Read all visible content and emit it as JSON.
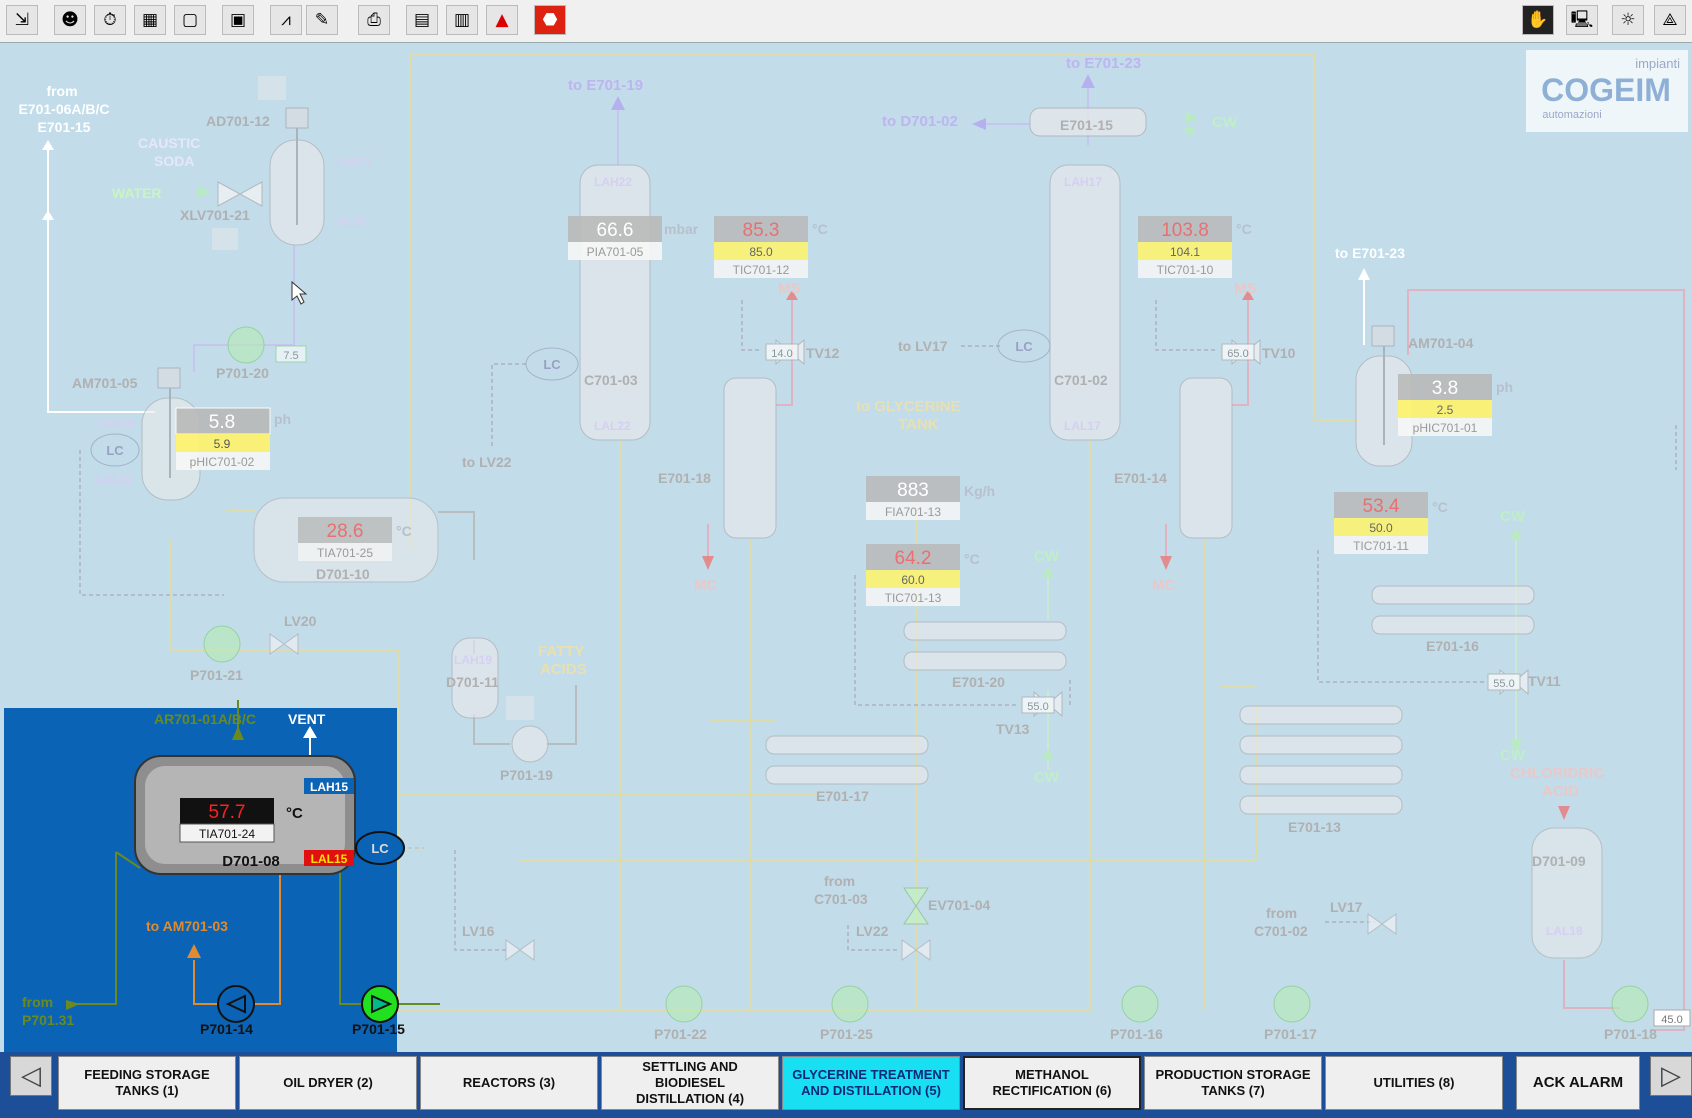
{
  "toolbar": {
    "left_icons": [
      "exit-icon",
      "users-icon",
      "stopwatch-icon",
      "calculator-icon",
      "display-icon",
      "counter-icon",
      "trend-icon",
      "report-icon",
      "printer-icon",
      "archive-icon",
      "table-icon",
      "warning-icon",
      "stop-icon"
    ],
    "right_icons": [
      "hand-stop-icon",
      "computer-icon",
      "brightness-icon",
      "tank-icon"
    ]
  },
  "logo": {
    "top": "impianti",
    "brand": "COGEIM",
    "bottom": "automazioni"
  },
  "colors": {
    "background": "#c2dcea",
    "inset_bg": "#0a63b4",
    "active_tab": "#18e0f2",
    "nav_bg": "#1d4f99",
    "value_gray": "#b9b9b9",
    "setpoint_yellow": "#fff36a",
    "alarm_red": "#e01010"
  },
  "labels": {
    "from_e70106": "from",
    "from_e70106_b": "E701-06A/B/C",
    "from_e70106_c": "E701-15",
    "caustic": "CAUSTIC",
    "soda": "SODA",
    "water": "WATER",
    "ad701_12": "AD701-12",
    "xlv701_21": "XLV701-21",
    "la821": "LA821",
    "al21": "AL21",
    "to_e70119": "to E701-19",
    "to_e70123_top": "to E701-23",
    "to_d70102": "to D701-02",
    "e701_15": "E701-15",
    "cw": "CW",
    "to_e70123_right": "to E701-23",
    "am701_05": "AM701-05",
    "p701_20": "P701-20",
    "lah20": "LAH20",
    "lal20": "LAL20",
    "lc": "LC",
    "d701_10": "D701-10",
    "lv20": "LV20",
    "p701_21": "P701-21",
    "to_lv22": "to LV22",
    "c701_03": "C701-03",
    "lah22": "LAH22",
    "lal22": "LAL22",
    "e701_18": "E701-18",
    "ms": "MS",
    "mc": "MC",
    "tv12": "TV12",
    "to_lv17": "to LV17",
    "c701_02": "C701-02",
    "lah17": "LAH17",
    "lal17": "LAL17",
    "e701_14": "E701-14",
    "tv10": "TV10",
    "to_glycerine": "to GLYCERINE",
    "tank": "TANK",
    "am701_04": "AM701-04",
    "e701_20": "E701-20",
    "tv13": "TV13",
    "e701_17": "E701-17",
    "e701_16": "E701-16",
    "tv11": "TV11",
    "e701_13": "E701-13",
    "chloridric": "CHLORIDRIC",
    "acid": "ACID",
    "d701_09": "D701-09",
    "lal18": "LAL18",
    "d701_11": "D701-11",
    "lah19": "LAH19",
    "fatty": "FATTY",
    "acids": "ACIDS",
    "p701_19": "P701-19",
    "lv16": "LV16",
    "from_c70103": "from",
    "from_c70103_b": "C701-03",
    "lv22": "LV22",
    "ev701_04": "EV701-04",
    "from_c70102": "from",
    "from_c70102_b": "C701-02",
    "lv17": "LV17",
    "p701_22": "P701-22",
    "p701_25": "P701-25",
    "p701_16": "P701-16",
    "p701_17": "P701-17",
    "p701_18": "P701-18",
    "kgh": "Kg/h",
    "degc": "°C",
    "mbar": "mbar",
    "ph": "ph"
  },
  "instruments": {
    "pia701_05": {
      "value": "66.6",
      "tag": "PIA701-05"
    },
    "tic701_12": {
      "value": "85.3",
      "sp": "85.0",
      "tag": "TIC701-12"
    },
    "tic701_10": {
      "value": "103.8",
      "sp": "104.1",
      "tag": "TIC701-10"
    },
    "phic701_01": {
      "value": "3.8",
      "sp": "2.5",
      "tag": "pHIC701-01"
    },
    "phic701_02": {
      "value": "5.8",
      "sp": "5.9",
      "tag": "pHIC701-02"
    },
    "tia701_25": {
      "value": "28.6",
      "tag": "TIA701-25"
    },
    "fia701_13": {
      "value": "883",
      "tag": "FIA701-13"
    },
    "tic701_13": {
      "value": "64.2",
      "sp": "60.0",
      "tag": "TIC701-13"
    },
    "tic701_11": {
      "value": "53.4",
      "sp": "50.0",
      "tag": "TIC701-11"
    },
    "valve_outputs": {
      "tv12": "14.0",
      "tv10": "65.0",
      "tv13": "55.0",
      "tv11": "55.0",
      "p701_20": "7.5",
      "p701_18": "45.0"
    }
  },
  "inset": {
    "ar701": "AR701-01A/B/C",
    "vent": "VENT",
    "lah15": "LAH15",
    "lal15": "LAL15",
    "temp": "57.7",
    "unit": "°C",
    "tag": "TIA701-24",
    "tank": "D701-08",
    "lc": "LC",
    "to_am": "to AM701-03",
    "from": "from",
    "from_p": "P701.31",
    "p701_14": "P701-14",
    "p701_15": "P701-15"
  },
  "nav": {
    "prev": "◁",
    "next": "▷",
    "tabs": [
      {
        "line1": "FEEDING STORAGE",
        "line2": "TANKS (1)",
        "line3": ""
      },
      {
        "line1": "OIL DRYER (2)",
        "line2": "",
        "line3": ""
      },
      {
        "line1": "REACTORS (3)",
        "line2": "",
        "line3": ""
      },
      {
        "line1": "SETTLING AND",
        "line2": "BIODIESEL",
        "line3": "DISTILLATION (4)"
      },
      {
        "line1": "GLYCERINE TREATMENT",
        "line2": "AND DISTILLATION (5)",
        "line3": ""
      },
      {
        "line1": "METHANOL",
        "line2": "RECTIFICATION (6)",
        "line3": ""
      },
      {
        "line1": "PRODUCTION STORAGE",
        "line2": "TANKS (7)",
        "line3": ""
      },
      {
        "line1": "UTILITIES (8)",
        "line2": "",
        "line3": ""
      }
    ],
    "ack": "ACK ALARM"
  }
}
